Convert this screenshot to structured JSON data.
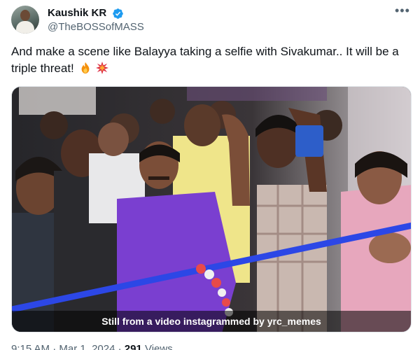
{
  "author": {
    "display_name": "Kaushik KR",
    "handle": "@TheBOSSofMASS",
    "verified": true,
    "avatar_icon": "profile-avatar"
  },
  "tweet": {
    "text": "And make a scene like Balayya taking a selfie with Sivakumar.. It will be a triple threat!",
    "emojis": [
      "fire-emoji",
      "collision-emoji"
    ]
  },
  "media": {
    "caption": "Still from a video instagrammed by yrc_memes",
    "ribbon_color": "#2c47e6",
    "shirt_color": "#7a3fd0"
  },
  "meta": {
    "time": "9:15 AM",
    "separator": "·",
    "date": "Mar 1, 2024",
    "views_count": "291",
    "views_label": "Views"
  },
  "colors": {
    "text_primary": "#0f1419",
    "text_secondary": "#536471",
    "verified_badge": "#1d9bf0"
  }
}
